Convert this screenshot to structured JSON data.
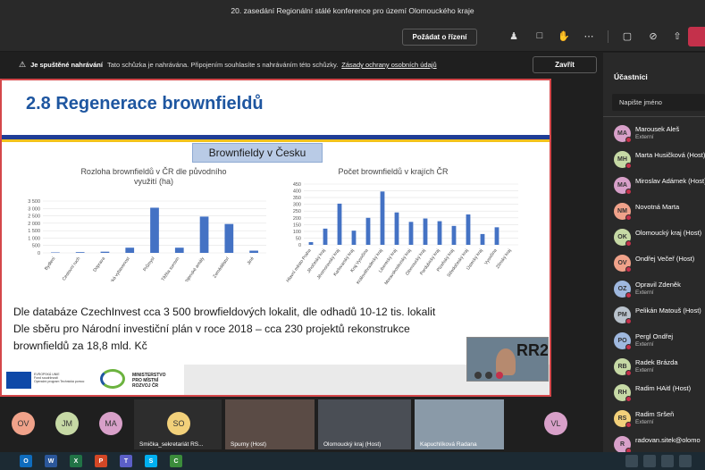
{
  "window": {
    "title": "20. zasedání Regionální stálé konference pro území Olomouckého kraje"
  },
  "toolbar": {
    "request_control": "Požádat o řízení"
  },
  "notice": {
    "bold": "Je spuštěné nahrávání",
    "text": "Tato schůzka je nahrávána. Připojením souhlasíte s nahráváním této schůzky.",
    "link": "Zásady ochrany osobních údajů",
    "close": "Zavřít"
  },
  "slide": {
    "title": "2.8  Regenerace brownfieldů",
    "subtitle": "Brownfieldy v Česku",
    "text_lines": [
      "Dle databáze CzechInvest cca 3 500 browfieldových lokalit, dle odhadů 10-12 tis. lokalit",
      "Dle sběru pro Národní investiční plán v roce 2018 – cca 230 projektů rekonstrukce",
      "brownfieldů za 18,8 mld. Kč"
    ],
    "logo_eu_text": [
      "EVROPSKÁ UNIE",
      "Fond soudržnosti",
      "Operační program Technická pomoc"
    ],
    "logo_mmr_text": [
      "MINISTERSTVO",
      "PRO MÍSTNÍ",
      "ROZVOJ ČR"
    ]
  },
  "chart_data": [
    {
      "type": "bar",
      "title": "Rozloha brownfieldů v ČR dle původního využití (ha)",
      "categories": [
        "Bydlení",
        "Cestovní ruch",
        "Doprava",
        "Občanská vybavenost",
        "Průmysl",
        "Těžba surovin",
        "Vojenské areály",
        "Zemědělství",
        "Jiné"
      ],
      "values": [
        30,
        50,
        80,
        350,
        3050,
        350,
        2450,
        1950,
        150
      ],
      "yticks": [
        "0",
        "500",
        "1 000",
        "1 500",
        "2 000",
        "2 500",
        "3 000",
        "3 500"
      ],
      "ylim": [
        0,
        3500
      ],
      "color": "#4472c4"
    },
    {
      "type": "bar",
      "title": "Počet brownfieldů v krajích ČR",
      "categories": [
        "Hlavní město Praha",
        "Jihočeský kraj",
        "Jihomoravský kraj",
        "Karlovarský kraj",
        "Kraj Vysočina",
        "Královéhradecký kraj",
        "Liberecký kraj",
        "Moravskoslezský kraj",
        "Olomoucký kraj",
        "Pardubický kraj",
        "Plzeňský kraj",
        "Středočeský kraj",
        "Ústecký kraj",
        "Vysočina",
        "Zlínský kraj"
      ],
      "values": [
        20,
        120,
        305,
        105,
        200,
        395,
        240,
        170,
        195,
        175,
        140,
        225,
        80,
        130,
        0
      ],
      "yticks": [
        "0",
        "50",
        "100",
        "150",
        "200",
        "250",
        "300",
        "350",
        "400",
        "450"
      ],
      "ylim": [
        0,
        450
      ],
      "color": "#4472c4"
    }
  ],
  "panel": {
    "title": "Účastníci",
    "search_placeholder": "Napište jméno",
    "participants": [
      {
        "initials": "MA",
        "name": "Marousek Aleš",
        "sub": "Externí",
        "color": "#d8a0c9"
      },
      {
        "initials": "MH",
        "name": "Marta Husičková (Host)",
        "sub": "",
        "color": "#c6d9a5"
      },
      {
        "initials": "MA",
        "name": "Miroslav Adámek (Host)",
        "sub": "",
        "color": "#d8a0c9"
      },
      {
        "initials": "NM",
        "name": "Novotná Marta",
        "sub": "",
        "color": "#f0a28a"
      },
      {
        "initials": "OK",
        "name": "Olomoucký kraj (Host)",
        "sub": "",
        "color": "#c6d9a5"
      },
      {
        "initials": "OV",
        "name": "Ondřej Večeř (Host)",
        "sub": "",
        "color": "#f0a28a"
      },
      {
        "initials": "OZ",
        "name": "Opravil Zdeněk",
        "sub": "Externí",
        "color": "#9fb8df"
      },
      {
        "initials": "PM",
        "name": "Pelikán Matouš (Host)",
        "sub": "",
        "color": "#b9c2cc"
      },
      {
        "initials": "PO",
        "name": "Pergl Ondřej",
        "sub": "Externí",
        "color": "#9fb8df"
      },
      {
        "initials": "RB",
        "name": "Radek Brázda",
        "sub": "Externí",
        "color": "#c6d9a5"
      },
      {
        "initials": "RH",
        "name": "Radim HAitl (Host)",
        "sub": "",
        "color": "#c6d9a5"
      },
      {
        "initials": "RS",
        "name": "Radim Sršeň",
        "sub": "Externí",
        "color": "#f2d07a"
      },
      {
        "initials": "R",
        "name": "radovan.sitek@olomo",
        "sub": "",
        "color": "#d8a0c9"
      }
    ]
  },
  "strip": {
    "avatars": [
      {
        "initials": "OV",
        "color": "#f0a28a"
      },
      {
        "initials": "JM",
        "color": "#c6d9a5"
      },
      {
        "initials": "MA",
        "color": "#d8a0c9"
      },
      {
        "initials": "SO",
        "color": "#f2d07a"
      },
      {
        "initials": "VL",
        "color": "#d8a0c9"
      }
    ],
    "tiles": [
      "Smička_sekretariát RS...",
      "Spurny (Host)",
      "Olomoucký kraj (Host)",
      "Kapuchlíková Radana"
    ]
  },
  "taskbar": {
    "icons": [
      "O",
      "W",
      "X",
      "P",
      "T",
      "S",
      "C"
    ]
  }
}
